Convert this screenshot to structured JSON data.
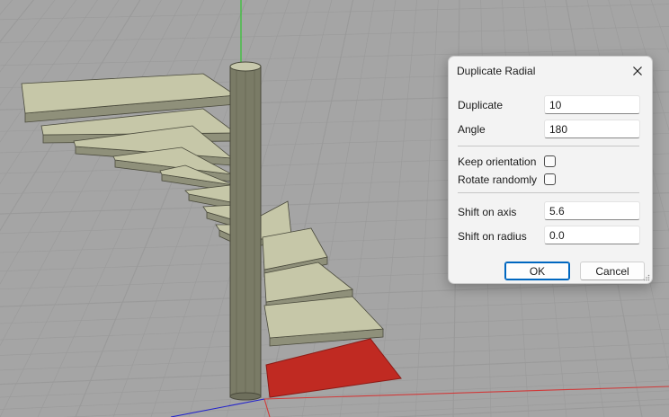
{
  "viewport": {
    "floor_color": "#a5a5a5",
    "grid_color": "#9a9a9a",
    "tread_color": "#c6c7a8",
    "column_color": "#7a7b66",
    "selection_color": "#c02a22",
    "axis_colors": {
      "x": "#d03a3a",
      "y": "#2222cc",
      "z": "#40c040"
    }
  },
  "dialog": {
    "title": "Duplicate Radial",
    "close_icon": "close-icon",
    "fields": {
      "duplicate": {
        "label": "Duplicate",
        "value": "10"
      },
      "angle": {
        "label": "Angle",
        "value": "180"
      },
      "shift_axis": {
        "label": "Shift on axis",
        "value": "5.6"
      },
      "shift_radius": {
        "label": "Shift on radius",
        "value": "0.0"
      }
    },
    "options": {
      "keep_orientation": {
        "label": "Keep orientation",
        "checked": false
      },
      "rotate_randomly": {
        "label": "Rotate randomly",
        "checked": false
      }
    },
    "ok_label": "OK",
    "cancel_label": "Cancel"
  }
}
